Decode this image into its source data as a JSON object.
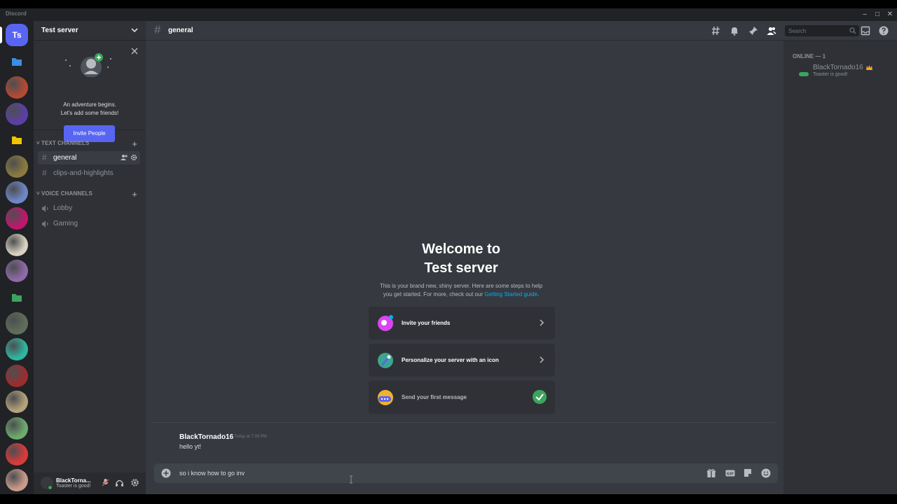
{
  "window": {
    "title": "Discord",
    "controls": [
      "minimize-icon",
      "maximize-icon",
      "close-icon"
    ]
  },
  "guilds": {
    "home_label": "Ts",
    "items": [
      {
        "name": "folder-icon",
        "color": "#3a8ee6"
      },
      {
        "name": "server-avatar-1",
        "color": "#b34a32"
      },
      {
        "name": "server-avatar-2",
        "color": "#5b3fa6"
      },
      {
        "name": "folder-icon",
        "color": "#f5c400"
      },
      {
        "name": "server-avatar-3",
        "color": "#8a7a3d"
      },
      {
        "name": "server-avatar-4",
        "color": "#6f86c6"
      },
      {
        "name": "server-avatar-5",
        "color": "#c0166d"
      },
      {
        "name": "server-avatar-6",
        "color": "#d8d0c0"
      },
      {
        "name": "server-avatar-7",
        "color": "#8e6aa8"
      },
      {
        "name": "folder-icon",
        "color": "#3ba55d"
      },
      {
        "name": "server-avatar-8",
        "color": "#5f6d5a"
      },
      {
        "name": "server-avatar-9",
        "color": "#2fb5a0"
      },
      {
        "name": "server-avatar-10",
        "color": "#9c2d2d"
      },
      {
        "name": "server-avatar-11",
        "color": "#b3a27a"
      },
      {
        "name": "server-avatar-12",
        "color": "#6eaa6e"
      },
      {
        "name": "server-avatar-13",
        "color": "#d93a3a"
      },
      {
        "name": "server-avatar-14",
        "color": "#c99a8a"
      }
    ]
  },
  "sidebar": {
    "server_name": "Test server",
    "invite_card": {
      "line1": "An adventure begins.",
      "line2": "Let's add some friends!",
      "button": "Invite People"
    },
    "categories": [
      {
        "label": "TEXT CHANNELS",
        "channels": [
          {
            "name": "general",
            "type": "text",
            "active": true
          },
          {
            "name": "clips-and-highlights",
            "type": "text",
            "active": false
          }
        ]
      },
      {
        "label": "VOICE CHANNELS",
        "channels": [
          {
            "name": "Lobby",
            "type": "voice",
            "active": false
          },
          {
            "name": "Gaming",
            "type": "voice",
            "active": false
          }
        ]
      }
    ],
    "hash_symbol": "#",
    "plus_symbol": "+"
  },
  "user_panel": {
    "name": "BlackTorna...",
    "status_text": "Toaster is good!"
  },
  "chat": {
    "channel_name": "general",
    "hash_symbol": "#",
    "search_placeholder": "Search",
    "welcome_line1": "Welcome to",
    "welcome_line2": "Test server",
    "welcome_desc_line1": "This is your brand new, shiny server. Here are some steps to help",
    "welcome_desc_line2": "you get started. For more, check out our ",
    "welcome_link": "Getting Started guide",
    "welcome_desc_end": ".",
    "steps": [
      {
        "label": "Invite your friends",
        "done": false
      },
      {
        "label": "Personalize your server with an icon",
        "done": false
      },
      {
        "label": "Send your first message",
        "done": true
      }
    ],
    "message": {
      "author": "BlackTornado16",
      "timestamp": "Today at 7:39 PM",
      "text": "hello yt!"
    },
    "composer_value": "so i know how to go inv"
  },
  "members": {
    "category": "ONLINE — 1",
    "list": [
      {
        "name": "BlackTornado16",
        "status_text": "Toaster is good!",
        "owner": true
      }
    ]
  },
  "colors": {
    "accent": "#5865f2",
    "online": "#3ba55d",
    "link": "#00aff4",
    "crown": "#faa61a"
  }
}
